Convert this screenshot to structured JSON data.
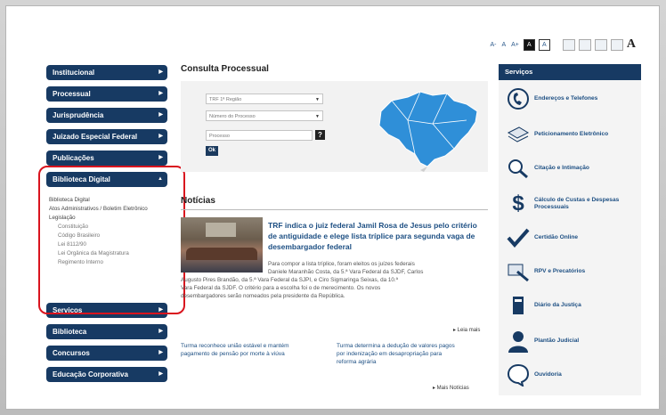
{
  "accessibility": {
    "small_a": "A-",
    "normal_a": "A",
    "big_a": "A+",
    "contrast_dark": "A",
    "contrast_light": "A",
    "font_icon": "A"
  },
  "left_menu": {
    "items_top": [
      "Institucional",
      "Processual",
      "Jurisprudência",
      "Juizado Especial Federal",
      "Publicações"
    ],
    "expanded_label": "Biblioteca Digital",
    "sub_items": [
      "Biblioteca Digital",
      "Atos Administrativos / Boletim Eletrônico",
      "Legislação"
    ],
    "legislation_items": [
      "Constituição",
      "Código Brasileiro",
      "Lei 8112/90",
      "Lei Orgânica da Magistratura",
      "Regimento Interno"
    ],
    "items_bottom": [
      "Serviços",
      "Biblioteca",
      "Concursos",
      "Educação Corporativa"
    ]
  },
  "consulta": {
    "title": "Consulta Processual",
    "select_region": "TRF 1ª Região",
    "select_type": "Número do Processo",
    "input_placeholder": "Processo",
    "help_label": "?",
    "ok_label": "Ok"
  },
  "news": {
    "title": "Notícias",
    "headline": "TRF indica o juiz federal Jamil Rosa de Jesus pelo critério de antiguidade e elege lista tríplice para segunda vaga de desembargador federal",
    "body_indented": [
      "Para compor a lista tríplice, foram eleitos os juízes federais",
      "Daniele Maranhão Costa, da 5.ª Vara Federal da SJDF, Carlos"
    ],
    "body_full": [
      "Augusto Pires Brandão, da 5.ª Vara Federal da SJPI, e Ciro Sigmaringa Seixas, da 10.ª",
      "Vara Federal da SJDF. O critério para a escolha foi o de merecimento. Os novos",
      "desembargadores serão nomeados pela presidente da República."
    ],
    "read_more": "▸ Leia mais",
    "item2_left": "Turma reconhece união estável e mantém pagamento de pensão por morte à viúva",
    "item2_right": "Turma determina a dedução de valores pagos por indenização em desapropriação para reforma agrária",
    "more_news": "▸ Mais Notícias"
  },
  "services": {
    "title": "Serviços",
    "items": [
      {
        "label": "Endereços e Telefones",
        "icon": "contact-icon"
      },
      {
        "label": "Peticionamento Eletrônico",
        "icon": "document-icon"
      },
      {
        "label": "Citação e Intimação",
        "icon": "magnifier-icon"
      },
      {
        "label": "Cálculo de Custas e Despesas Processuais",
        "icon": "dollar-icon"
      },
      {
        "label": "Certidão Online",
        "icon": "checkmark-icon"
      },
      {
        "label": "RPV e Precatórios",
        "icon": "gavel-icon"
      },
      {
        "label": "Diário da Justiça",
        "icon": "book-icon"
      },
      {
        "label": "Plantão Judicial",
        "icon": "person-icon"
      },
      {
        "label": "Ouvidoria",
        "icon": "speech-bubble-icon"
      }
    ]
  },
  "colors": {
    "menu_bg": "#173a63",
    "link": "#1d4f83",
    "highlight": "#d9141e"
  }
}
